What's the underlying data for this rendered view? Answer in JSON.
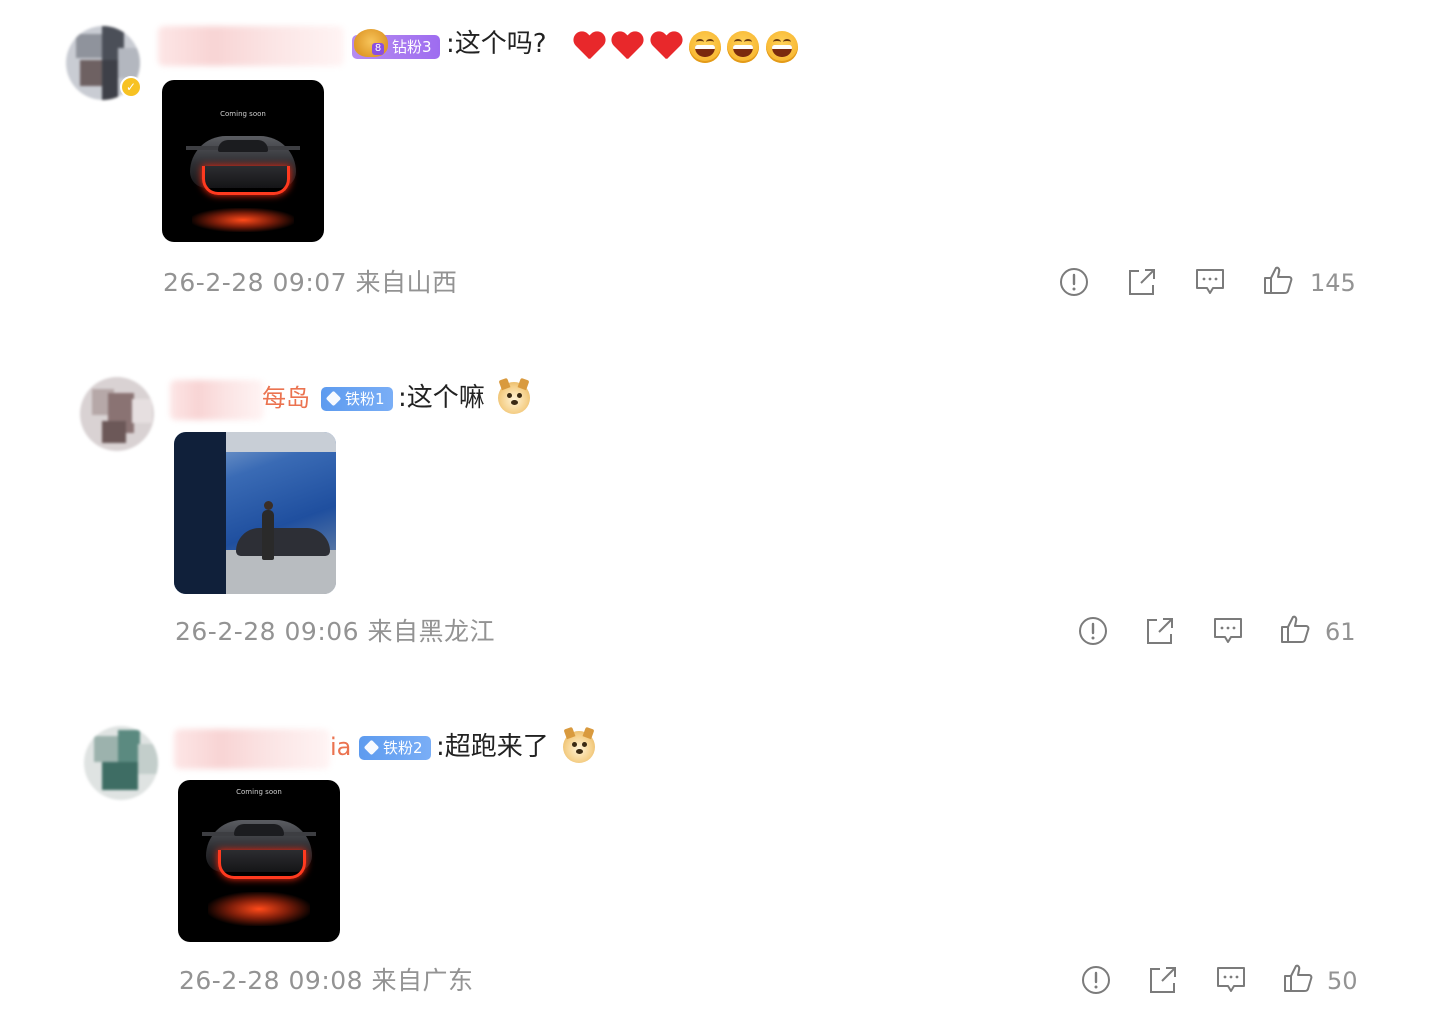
{
  "comments": [
    {
      "badge_label": "钻粉3",
      "badge_level_mark": "8",
      "text": ":这个吗?",
      "image_caption": "Coming soon",
      "timestamp": "26-2-28 09:07",
      "location": "来自山西",
      "likes": "145",
      "emoji_names": [
        "heart",
        "heart",
        "heart",
        "laugh",
        "laugh",
        "laugh"
      ]
    },
    {
      "name_suffix": "每岛",
      "badge_label": "铁粉1",
      "text": ":这个嘛",
      "timestamp": "26-2-28 09:06",
      "location": "来自黑龙江",
      "likes": "61",
      "emoji_names": [
        "doge"
      ]
    },
    {
      "name_suffix": "ia",
      "badge_label": "铁粉2",
      "text": ":超跑来了",
      "image_caption": "Coming soon",
      "timestamp": "26-2-28 09:08",
      "location": "来自广东",
      "likes": "50",
      "emoji_names": [
        "doge"
      ]
    }
  ],
  "icons": {
    "report": "report-icon",
    "share": "share-icon",
    "reply": "reply-icon",
    "like": "thumbs-up-icon"
  },
  "colors": {
    "meta_gray": "#939393",
    "name_orange": "#eb7350",
    "diamond_badge": "#a97cf0",
    "iron_badge": "#6aa3f2",
    "text": "#222222"
  }
}
